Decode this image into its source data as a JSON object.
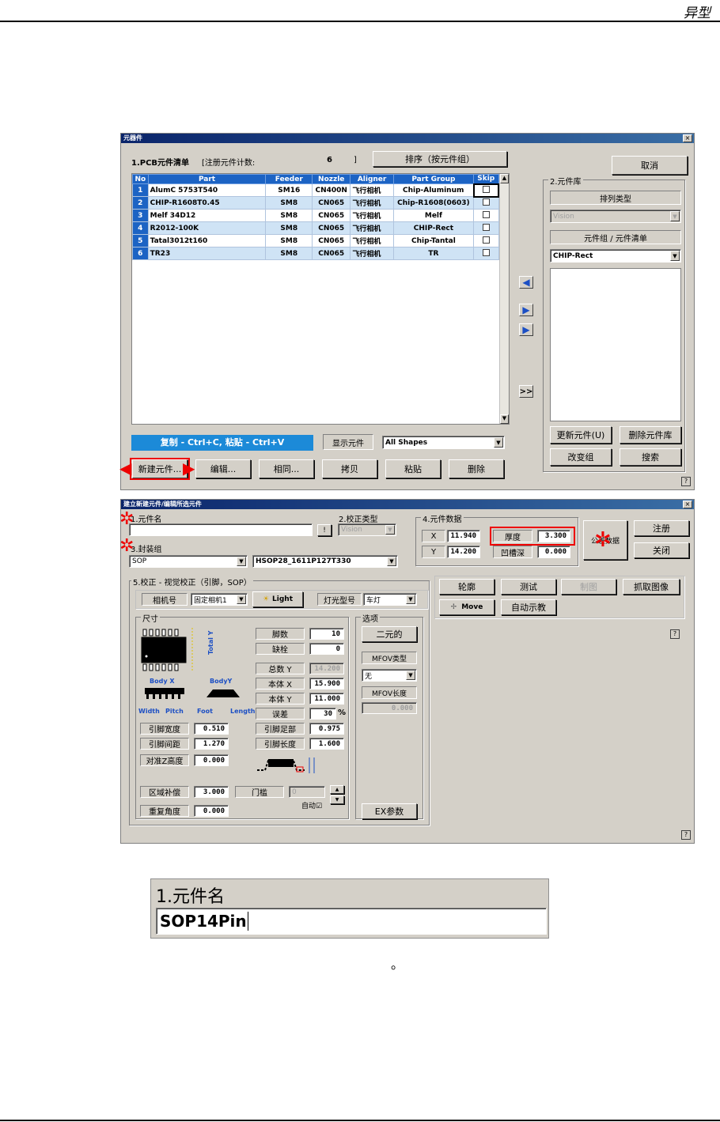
{
  "page": {
    "header_title": "异型",
    "caption_period": "。"
  },
  "dialog1": {
    "title": "元器件",
    "close": "×",
    "pcb_list_label": "1.PCB元件清单",
    "count_label": "[注册元件计数:",
    "count_value": "6",
    "count_close": "]",
    "sort_button": "排序（按元件组）",
    "cancel_button": "取消",
    "columns": [
      "No",
      "Part",
      "Feeder",
      "Nozzle",
      "Aligner",
      "Part Group",
      "Skip"
    ],
    "rows": [
      {
        "no": "1",
        "part": "AlumC 5753T540",
        "feeder": "SM16",
        "nozzle": "CN400N",
        "aligner": "飞行相机",
        "group": "Chip-Aluminum"
      },
      {
        "no": "2",
        "part": "CHIP-R1608T0.45",
        "feeder": "SM8",
        "nozzle": "CN065",
        "aligner": "飞行相机",
        "group": "Chip-R1608(0603)"
      },
      {
        "no": "3",
        "part": "Melf 34D12",
        "feeder": "SM8",
        "nozzle": "CN065",
        "aligner": "飞行相机",
        "group": "Melf"
      },
      {
        "no": "4",
        "part": "R2012-100K",
        "feeder": "SM8",
        "nozzle": "CN065",
        "aligner": "飞行相机",
        "group": "CHIP-Rect"
      },
      {
        "no": "5",
        "part": "Tatal3012t160",
        "feeder": "SM8",
        "nozzle": "CN065",
        "aligner": "飞行相机",
        "group": "Chip-Tantal"
      },
      {
        "no": "6",
        "part": "TR23",
        "feeder": "SM8",
        "nozzle": "CN065",
        "aligner": "飞行相机",
        "group": "TR"
      }
    ],
    "copy_hint": "复制 - Ctrl+C, 粘贴 - Ctrl+V",
    "show_label": "显示元件",
    "show_value": "All Shapes",
    "buttons": [
      "新建元件...",
      "编辑...",
      "相同...",
      "拷贝",
      "粘贴",
      "删除"
    ],
    "lib_label": "2.元件库",
    "sort_type": "排列类型",
    "vision_value": "Vision",
    "group_list_label": "元件组 / 元件清单",
    "group_value": "CHIP-Rect",
    "update_button": "更新元件(U)",
    "delete_lib_button": "删除元件库",
    "change_group_button": "改变组",
    "search_button": "搜索",
    "more": ">>",
    "help": "?"
  },
  "dialog2": {
    "title": "建立新建元件/编辑所选元件",
    "close": "×",
    "name_label": "1.元件名",
    "name_btn": "!",
    "calib_type_label": "2.校正类型",
    "calib_value": "Vision",
    "group_label": "3.封装组",
    "group_value": "SOP",
    "package_value": "HSOP28_1611P127T330",
    "data_label": "4.元件数据",
    "x_label": "X",
    "x_value": "11.940",
    "y_label": "Y",
    "y_value": "14.200",
    "thick_label": "厚度",
    "thick_value": "3.300",
    "groove_label": "凹槽深",
    "groove_value": "0.000",
    "pkg_data_btn": "公差数据",
    "register_btn": "注册",
    "close_btn": "关闭",
    "calib_section": "5.校正 - 视觉校正（引脚，SOP）",
    "camera_label": "相机号",
    "camera_value": "固定相机1",
    "light_btn": "Light",
    "light_type_label": "灯光型号",
    "light_type_value": "车灯",
    "outline_btn": "轮廓",
    "test_btn": "测试",
    "drawing_btn": "制图",
    "capture_btn": "抓取图像",
    "move_btn": "Move",
    "auto_teach_btn": "自动示教",
    "size_label": "尺寸",
    "options_label": "选项",
    "lead_count_label": "脚数",
    "lead_count": "10",
    "missing_label": "缺栓",
    "missing": "0",
    "total_y_label": "总数 Y",
    "total_y": "14.200",
    "body_x_label": "本体 X",
    "body_x": "15.900",
    "body_y_label": "本体 Y",
    "body_y": "11.000",
    "tolerance_label": "误差",
    "tolerance": "30",
    "percent": "%",
    "lead_width_label": "引脚宽度",
    "lead_width": "0.510",
    "lead_pitch_label": "引脚间距",
    "lead_pitch": "1.270",
    "foot_label": "引脚足部",
    "foot": "0.975",
    "lead_len_label": "引脚长度",
    "lead_len": "1.600",
    "z_height_label": "对准Z高度",
    "z_height": "0.000",
    "area_label": "区域补偿",
    "area": "3.000",
    "threshold_label": "门槛",
    "threshold": "0",
    "auto_label": "自动☑",
    "repeat_label": "重复角度",
    "repeat": "0.000",
    "binary_btn": "二元的",
    "mfov_type_label": "MFOV类型",
    "mfov_type": "无",
    "mfov_len_label": "MFOV长度",
    "mfov_len": "0.000",
    "ex_btn": "EX参数",
    "diag_labels": {
      "total_y": "Total Y",
      "body_x": "Body X",
      "body_y": "BodyY",
      "width": "Width",
      "pitch": "Pitch",
      "foot": "Foot",
      "length": "Length"
    },
    "help": "?"
  },
  "zoom": {
    "label": "1.元件名",
    "value": "SOP14Pin"
  }
}
